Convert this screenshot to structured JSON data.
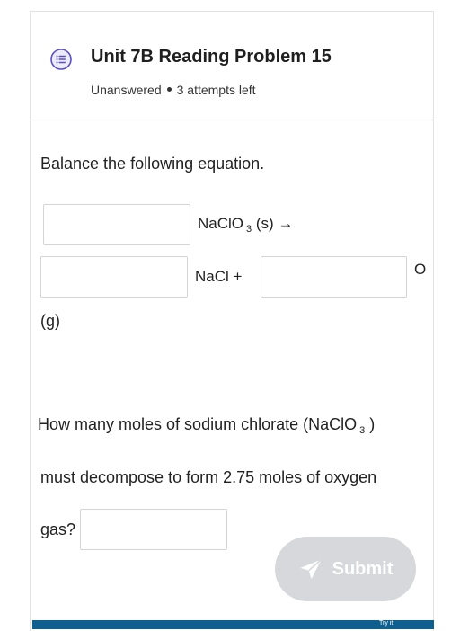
{
  "question": {
    "title": "Unit 7B Reading Problem 15",
    "status": "Unanswered",
    "attempts": "3 attempts left"
  },
  "part1": {
    "instruction": "Balance the following equation.",
    "reactant": "NaClO",
    "reactant_sub": "3",
    "reactant_state": "(s) →",
    "product1": "NaCl  +",
    "product2_prefix": "O",
    "state_line": "(g)"
  },
  "part2": {
    "question_line1_pre": "How many moles of sodium chlorate (NaClO",
    "question_line1_sub": "3",
    "question_line1_post": ")",
    "question_line2": "must decompose to form 2.75 moles of oxygen",
    "question_line3": "gas?"
  },
  "actions": {
    "submit_label": "Submit",
    "try_it_label": "Try it"
  },
  "colors": {
    "icon_accent": "#5b4fc4",
    "submit_disabled_bg": "#d6d8db",
    "footer_bar": "#0f5f8f"
  },
  "icons": {
    "header": "list-icon",
    "submit": "send-arrow-icon"
  }
}
